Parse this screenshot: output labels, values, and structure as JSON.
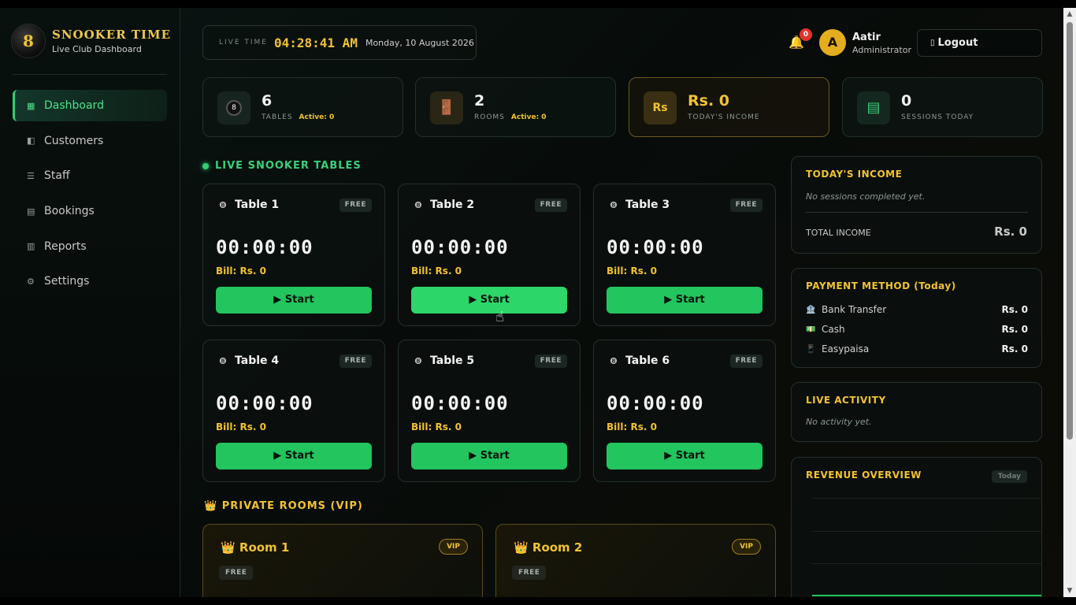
{
  "brand": {
    "logo_char": "8",
    "title": "SNOOKER TIME",
    "subtitle": "Live Club Dashboard"
  },
  "nav": [
    {
      "label": "Dashboard",
      "icon": "dashboard-icon",
      "active": true
    },
    {
      "label": "Customers",
      "icon": "customers-icon"
    },
    {
      "label": "Staff",
      "icon": "staff-icon"
    },
    {
      "label": "Bookings",
      "icon": "bookings-icon"
    },
    {
      "label": "Reports",
      "icon": "reports-icon"
    },
    {
      "label": "Settings",
      "icon": "settings-icon"
    }
  ],
  "header": {
    "live_label": "LIVE TIME",
    "time": "04:28:41 AM",
    "date": "Monday, 10 August 2026",
    "notifications": "0",
    "user_initial": "A",
    "user_name": "Aatir",
    "user_role": "Administrator",
    "logout_label": "Logout"
  },
  "stats": [
    {
      "value": "6",
      "label": "TABLES",
      "active": "Active: 0",
      "icon": "snooker-ball-icon"
    },
    {
      "value": "2",
      "label": "ROOMS",
      "active": "Active: 0",
      "icon": "door-icon"
    },
    {
      "value": "Rs. 0",
      "label": "TODAY'S INCOME",
      "icon_text": "Rs",
      "icon": "rupee-icon"
    },
    {
      "value": "0",
      "label": "SESSIONS TODAY",
      "icon": "ledger-icon"
    }
  ],
  "tables_section": {
    "title": "LIVE SNOOKER TABLES"
  },
  "tables": [
    {
      "name": "Table 1",
      "status": "FREE",
      "timer": "00:00:00",
      "bill": "Bill: Rs. 0",
      "start_label": "▶ Start"
    },
    {
      "name": "Table 2",
      "status": "FREE",
      "timer": "00:00:00",
      "bill": "Bill: Rs. 0",
      "start_label": "▶ Start"
    },
    {
      "name": "Table 3",
      "status": "FREE",
      "timer": "00:00:00",
      "bill": "Bill: Rs. 0",
      "start_label": "▶ Start"
    },
    {
      "name": "Table 4",
      "status": "FREE",
      "timer": "00:00:00",
      "bill": "Bill: Rs. 0",
      "start_label": "▶ Start"
    },
    {
      "name": "Table 5",
      "status": "FREE",
      "timer": "00:00:00",
      "bill": "Bill: Rs. 0",
      "start_label": "▶ Start"
    },
    {
      "name": "Table 6",
      "status": "FREE",
      "timer": "00:00:00",
      "bill": "Bill: Rs. 0",
      "start_label": "▶ Start"
    }
  ],
  "rooms_section": {
    "title": "👑 PRIVATE ROOMS (VIP)"
  },
  "rooms": [
    {
      "name": "👑 Room 1",
      "badge": "VIP",
      "status": "FREE"
    },
    {
      "name": "👑 Room 2",
      "badge": "VIP",
      "status": "FREE"
    }
  ],
  "income_panel": {
    "title": "TODAY'S INCOME",
    "empty": "No sessions completed yet.",
    "total_label": "TOTAL INCOME",
    "total_value": "Rs. 0"
  },
  "payment_panel": {
    "title": "PAYMENT METHOD (Today)",
    "methods": [
      {
        "name": "Bank Transfer",
        "value": "Rs. 0",
        "icon": "bank-icon"
      },
      {
        "name": "Cash",
        "value": "Rs. 0",
        "icon": "cash-icon"
      },
      {
        "name": "Easypaisa",
        "value": "Rs. 0",
        "icon": "mobile-icon"
      }
    ]
  },
  "activity_panel": {
    "title": "LIVE ACTIVITY",
    "empty": "No activity yet."
  },
  "revenue_panel": {
    "title": "REVENUE OVERVIEW",
    "badge": "Today"
  },
  "colors": {
    "accent_green": "#22c55e",
    "accent_gold": "#f2c230",
    "badge_red": "#e0332f"
  }
}
